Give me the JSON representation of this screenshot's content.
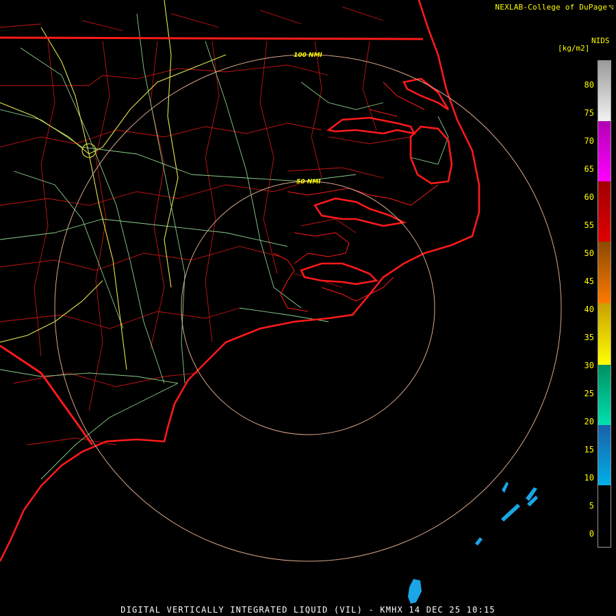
{
  "credit": {
    "text": "NEXLAB-College of DuPage",
    "logo_icon": "nexlab-logo-icon"
  },
  "legend": {
    "source": "NIDS",
    "unit": "[kg/m2]",
    "ticks": [
      "80",
      "75",
      "70",
      "65",
      "60",
      "55",
      "50",
      "45",
      "40",
      "35",
      "30",
      "25",
      "20",
      "15",
      "10",
      "5",
      "0"
    ],
    "colors": {
      "gray": "#9a9a9a",
      "white": "#f2f2f2",
      "magenta": "#b200b2",
      "pink": "#ff00ff",
      "darkred": "#a00000",
      "red": "#e00000",
      "brown": "#8a4a00",
      "orange": "#ff7a00",
      "gold": "#c8a000",
      "yellow": "#ffff00",
      "green": "#009060",
      "aqua": "#00e0b0",
      "blue": "#1a60a8",
      "cyan": "#00b0e8"
    }
  },
  "range_rings": [
    {
      "label": "100 NMI"
    },
    {
      "label": "50 NMI"
    }
  ],
  "footer": {
    "title": "DIGITAL VERTICALLY INTEGRATED LIQUID (VIL) - KMHX 14 DEC 25 10:15"
  },
  "map_colors": {
    "coast": "#ff1a1a",
    "county": "#c81414",
    "highway": "#8ccf8c",
    "interstate": "#e6e64a",
    "ring": "#d9a88a",
    "echo": "#1aa6e6"
  }
}
